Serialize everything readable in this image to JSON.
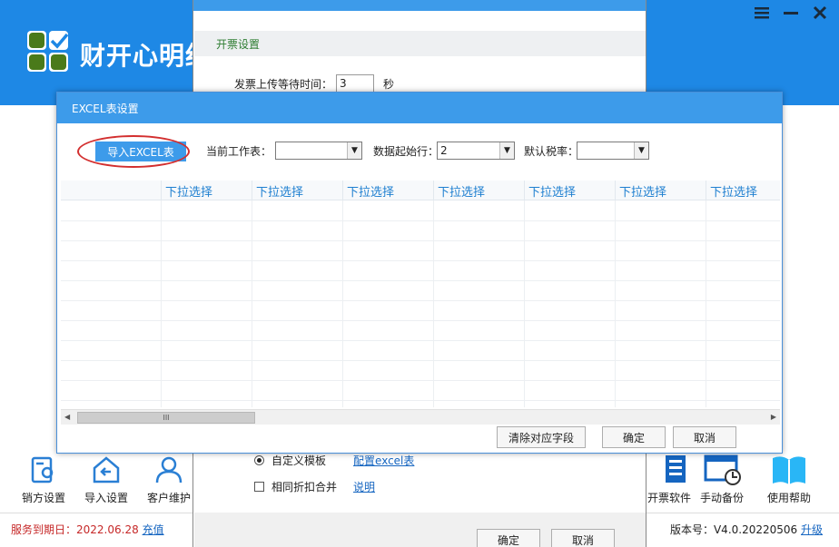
{
  "app": {
    "title": "财开心明细",
    "window_controls": [
      "menu-icon",
      "minimize-icon",
      "close-icon"
    ],
    "accent_color": "#1e88e5"
  },
  "toolbar_left": [
    {
      "label": "销方设置",
      "icon": "seller-icon"
    },
    {
      "label": "导入设置",
      "icon": "import-icon"
    },
    {
      "label": "客户维护",
      "icon": "customer-icon"
    }
  ],
  "toolbar_right": [
    {
      "label": "开票软件",
      "icon": "invoice-software-icon"
    },
    {
      "label": "手动备份",
      "icon": "backup-icon"
    },
    {
      "label": "使用帮助",
      "icon": "help-icon"
    }
  ],
  "status": {
    "expire_label": "服务到期日：",
    "expire_date": "2022.06.28",
    "recharge_link": "充值",
    "version_label": "版本号：",
    "version_value": "V4.0.20220506",
    "upgrade_link": "升级"
  },
  "invoice_dialog": {
    "section_title": "开票设置",
    "wait_label": "发票上传等待时间：",
    "wait_value": "3",
    "wait_unit": "秒",
    "custom_template_label": "自定义模板",
    "config_excel_link": "配置excel表",
    "merge_discount_label": "相同折扣合并",
    "merge_help_link": "说明",
    "ok_button": "确定",
    "cancel_button": "取消"
  },
  "excel_dialog": {
    "title": "EXCEL表设置",
    "import_button": "导入EXCEL表",
    "sheet_label": "当前工作表：",
    "sheet_value": "",
    "start_row_label": "数据起始行：",
    "start_row_value": "2",
    "tax_rate_label": "默认税率：",
    "tax_rate_value": "",
    "columns": [
      "",
      "下拉选择",
      "下拉选择",
      "下拉选择",
      "下拉选择",
      "下拉选择",
      "下拉选择",
      "下拉选择"
    ],
    "scroll_grip": "III",
    "clear_button": "清除对应字段",
    "ok_button": "确定",
    "cancel_button": "取消"
  }
}
